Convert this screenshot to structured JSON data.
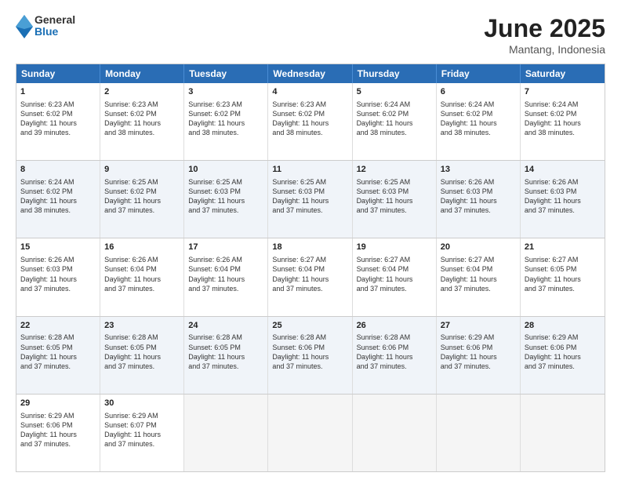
{
  "logo": {
    "general": "General",
    "blue": "Blue"
  },
  "title": {
    "month": "June 2025",
    "location": "Mantang, Indonesia"
  },
  "header_days": [
    "Sunday",
    "Monday",
    "Tuesday",
    "Wednesday",
    "Thursday",
    "Friday",
    "Saturday"
  ],
  "weeks": [
    {
      "alt": false,
      "cells": [
        {
          "day": "1",
          "lines": [
            "Sunrise: 6:23 AM",
            "Sunset: 6:02 PM",
            "Daylight: 11 hours",
            "and 39 minutes."
          ]
        },
        {
          "day": "2",
          "lines": [
            "Sunrise: 6:23 AM",
            "Sunset: 6:02 PM",
            "Daylight: 11 hours",
            "and 38 minutes."
          ]
        },
        {
          "day": "3",
          "lines": [
            "Sunrise: 6:23 AM",
            "Sunset: 6:02 PM",
            "Daylight: 11 hours",
            "and 38 minutes."
          ]
        },
        {
          "day": "4",
          "lines": [
            "Sunrise: 6:23 AM",
            "Sunset: 6:02 PM",
            "Daylight: 11 hours",
            "and 38 minutes."
          ]
        },
        {
          "day": "5",
          "lines": [
            "Sunrise: 6:24 AM",
            "Sunset: 6:02 PM",
            "Daylight: 11 hours",
            "and 38 minutes."
          ]
        },
        {
          "day": "6",
          "lines": [
            "Sunrise: 6:24 AM",
            "Sunset: 6:02 PM",
            "Daylight: 11 hours",
            "and 38 minutes."
          ]
        },
        {
          "day": "7",
          "lines": [
            "Sunrise: 6:24 AM",
            "Sunset: 6:02 PM",
            "Daylight: 11 hours",
            "and 38 minutes."
          ]
        }
      ]
    },
    {
      "alt": true,
      "cells": [
        {
          "day": "8",
          "lines": [
            "Sunrise: 6:24 AM",
            "Sunset: 6:02 PM",
            "Daylight: 11 hours",
            "and 38 minutes."
          ]
        },
        {
          "day": "9",
          "lines": [
            "Sunrise: 6:25 AM",
            "Sunset: 6:02 PM",
            "Daylight: 11 hours",
            "and 37 minutes."
          ]
        },
        {
          "day": "10",
          "lines": [
            "Sunrise: 6:25 AM",
            "Sunset: 6:03 PM",
            "Daylight: 11 hours",
            "and 37 minutes."
          ]
        },
        {
          "day": "11",
          "lines": [
            "Sunrise: 6:25 AM",
            "Sunset: 6:03 PM",
            "Daylight: 11 hours",
            "and 37 minutes."
          ]
        },
        {
          "day": "12",
          "lines": [
            "Sunrise: 6:25 AM",
            "Sunset: 6:03 PM",
            "Daylight: 11 hours",
            "and 37 minutes."
          ]
        },
        {
          "day": "13",
          "lines": [
            "Sunrise: 6:26 AM",
            "Sunset: 6:03 PM",
            "Daylight: 11 hours",
            "and 37 minutes."
          ]
        },
        {
          "day": "14",
          "lines": [
            "Sunrise: 6:26 AM",
            "Sunset: 6:03 PM",
            "Daylight: 11 hours",
            "and 37 minutes."
          ]
        }
      ]
    },
    {
      "alt": false,
      "cells": [
        {
          "day": "15",
          "lines": [
            "Sunrise: 6:26 AM",
            "Sunset: 6:03 PM",
            "Daylight: 11 hours",
            "and 37 minutes."
          ]
        },
        {
          "day": "16",
          "lines": [
            "Sunrise: 6:26 AM",
            "Sunset: 6:04 PM",
            "Daylight: 11 hours",
            "and 37 minutes."
          ]
        },
        {
          "day": "17",
          "lines": [
            "Sunrise: 6:26 AM",
            "Sunset: 6:04 PM",
            "Daylight: 11 hours",
            "and 37 minutes."
          ]
        },
        {
          "day": "18",
          "lines": [
            "Sunrise: 6:27 AM",
            "Sunset: 6:04 PM",
            "Daylight: 11 hours",
            "and 37 minutes."
          ]
        },
        {
          "day": "19",
          "lines": [
            "Sunrise: 6:27 AM",
            "Sunset: 6:04 PM",
            "Daylight: 11 hours",
            "and 37 minutes."
          ]
        },
        {
          "day": "20",
          "lines": [
            "Sunrise: 6:27 AM",
            "Sunset: 6:04 PM",
            "Daylight: 11 hours",
            "and 37 minutes."
          ]
        },
        {
          "day": "21",
          "lines": [
            "Sunrise: 6:27 AM",
            "Sunset: 6:05 PM",
            "Daylight: 11 hours",
            "and 37 minutes."
          ]
        }
      ]
    },
    {
      "alt": true,
      "cells": [
        {
          "day": "22",
          "lines": [
            "Sunrise: 6:28 AM",
            "Sunset: 6:05 PM",
            "Daylight: 11 hours",
            "and 37 minutes."
          ]
        },
        {
          "day": "23",
          "lines": [
            "Sunrise: 6:28 AM",
            "Sunset: 6:05 PM",
            "Daylight: 11 hours",
            "and 37 minutes."
          ]
        },
        {
          "day": "24",
          "lines": [
            "Sunrise: 6:28 AM",
            "Sunset: 6:05 PM",
            "Daylight: 11 hours",
            "and 37 minutes."
          ]
        },
        {
          "day": "25",
          "lines": [
            "Sunrise: 6:28 AM",
            "Sunset: 6:06 PM",
            "Daylight: 11 hours",
            "and 37 minutes."
          ]
        },
        {
          "day": "26",
          "lines": [
            "Sunrise: 6:28 AM",
            "Sunset: 6:06 PM",
            "Daylight: 11 hours",
            "and 37 minutes."
          ]
        },
        {
          "day": "27",
          "lines": [
            "Sunrise: 6:29 AM",
            "Sunset: 6:06 PM",
            "Daylight: 11 hours",
            "and 37 minutes."
          ]
        },
        {
          "day": "28",
          "lines": [
            "Sunrise: 6:29 AM",
            "Sunset: 6:06 PM",
            "Daylight: 11 hours",
            "and 37 minutes."
          ]
        }
      ]
    },
    {
      "alt": false,
      "cells": [
        {
          "day": "29",
          "lines": [
            "Sunrise: 6:29 AM",
            "Sunset: 6:06 PM",
            "Daylight: 11 hours",
            "and 37 minutes."
          ]
        },
        {
          "day": "30",
          "lines": [
            "Sunrise: 6:29 AM",
            "Sunset: 6:07 PM",
            "Daylight: 11 hours",
            "and 37 minutes."
          ]
        },
        {
          "day": "",
          "lines": []
        },
        {
          "day": "",
          "lines": []
        },
        {
          "day": "",
          "lines": []
        },
        {
          "day": "",
          "lines": []
        },
        {
          "day": "",
          "lines": []
        }
      ]
    }
  ]
}
